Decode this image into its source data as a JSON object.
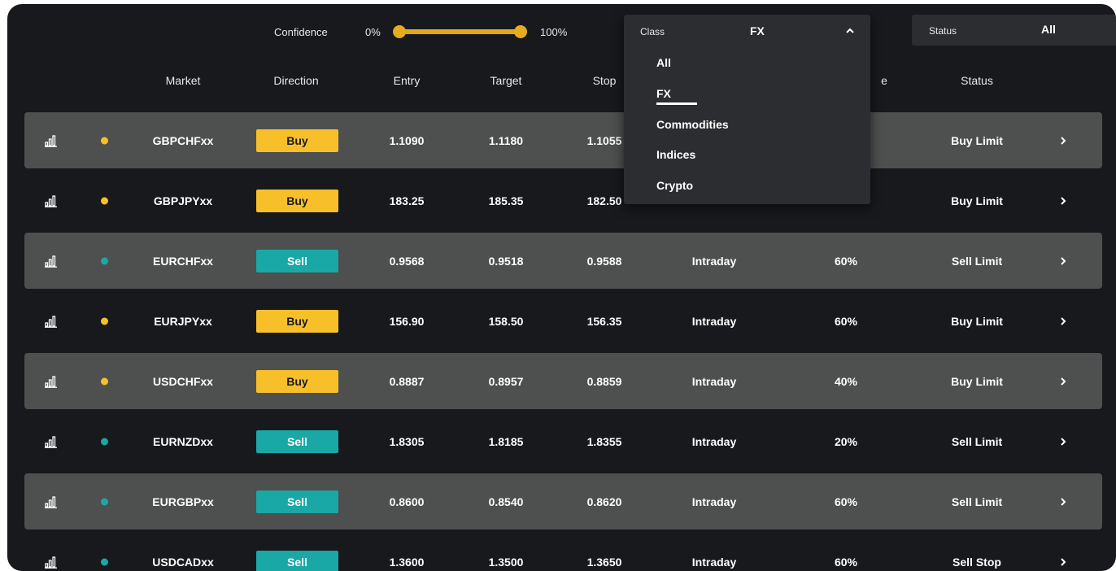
{
  "colors": {
    "buy": "#f7c02a",
    "sell": "#1aa8a6",
    "accent_slider": "#e0a81e",
    "row_alt": "#4e4f4f",
    "background": "#17191c"
  },
  "filters": {
    "confidence": {
      "label": "Confidence",
      "min_label": "0%",
      "max_label": "100%",
      "range_min": 0,
      "range_max": 100
    },
    "class": {
      "label": "Class",
      "value": "FX",
      "expanded": true,
      "options": [
        "All",
        "FX",
        "Commodities",
        "Indices",
        "Crypto"
      ],
      "selected_index": 1
    },
    "status": {
      "label": "Status",
      "value": "All"
    }
  },
  "columns": {
    "market": "Market",
    "direction": "Direction",
    "entry": "Entry",
    "target": "Target",
    "stop": "Stop",
    "partial_e": "e",
    "status": "Status"
  },
  "rows": [
    {
      "market": "GBPCHFxx",
      "direction": "Buy",
      "dot": "yellow",
      "entry": "1.1090",
      "target": "1.1180",
      "stop": "1.1055",
      "timeframe": "",
      "confidence": "",
      "status": "Buy Limit"
    },
    {
      "market": "GBPJPYxx",
      "direction": "Buy",
      "dot": "yellow",
      "entry": "183.25",
      "target": "185.35",
      "stop": "182.50",
      "timeframe": "",
      "confidence": "",
      "status": "Buy Limit"
    },
    {
      "market": "EURCHFxx",
      "direction": "Sell",
      "dot": "teal",
      "entry": "0.9568",
      "target": "0.9518",
      "stop": "0.9588",
      "timeframe": "Intraday",
      "confidence": "60%",
      "status": "Sell Limit"
    },
    {
      "market": "EURJPYxx",
      "direction": "Buy",
      "dot": "yellow",
      "entry": "156.90",
      "target": "158.50",
      "stop": "156.35",
      "timeframe": "Intraday",
      "confidence": "60%",
      "status": "Buy Limit"
    },
    {
      "market": "USDCHFxx",
      "direction": "Buy",
      "dot": "yellow",
      "entry": "0.8887",
      "target": "0.8957",
      "stop": "0.8859",
      "timeframe": "Intraday",
      "confidence": "40%",
      "status": "Buy Limit"
    },
    {
      "market": "EURNZDxx",
      "direction": "Sell",
      "dot": "teal",
      "entry": "1.8305",
      "target": "1.8185",
      "stop": "1.8355",
      "timeframe": "Intraday",
      "confidence": "20%",
      "status": "Sell Limit"
    },
    {
      "market": "EURGBPxx",
      "direction": "Sell",
      "dot": "teal",
      "entry": "0.8600",
      "target": "0.8540",
      "stop": "0.8620",
      "timeframe": "Intraday",
      "confidence": "60%",
      "status": "Sell Limit"
    },
    {
      "market": "USDCADxx",
      "direction": "Sell",
      "dot": "teal",
      "entry": "1.3600",
      "target": "1.3500",
      "stop": "1.3650",
      "timeframe": "Intraday",
      "confidence": "60%",
      "status": "Sell Stop"
    }
  ],
  "icons": {
    "row_chart": "bar-chart-icon",
    "row_open": "chevron-right-icon",
    "dropdown_toggle": "chevron-up-icon"
  }
}
